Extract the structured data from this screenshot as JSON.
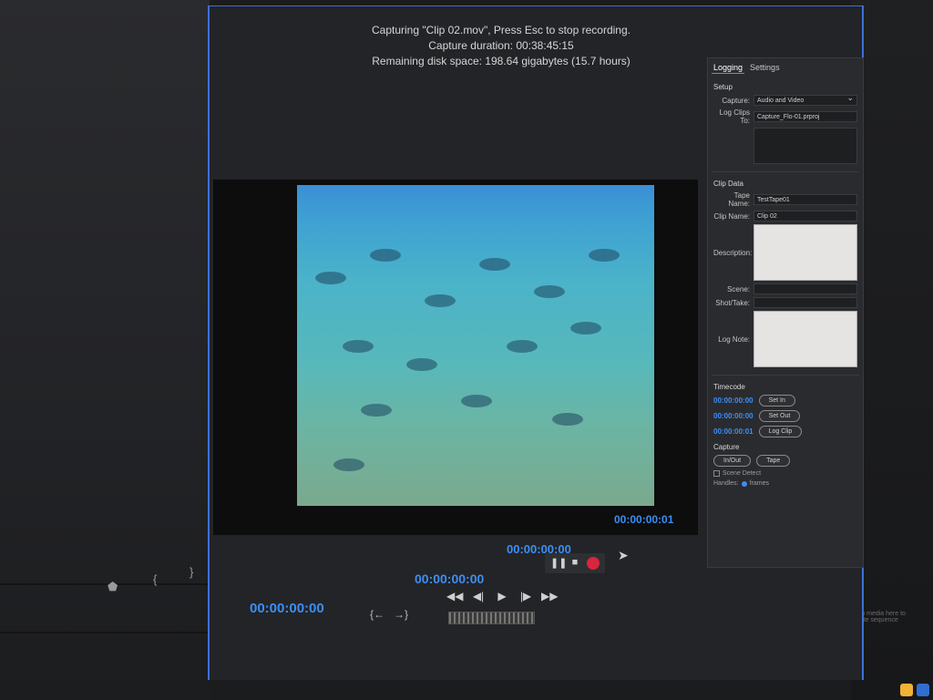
{
  "status": {
    "line1": "Capturing \"Clip 02.mov\", Press Esc to stop recording.",
    "line2": "Capture duration: 00:38:45:15",
    "line3": "Remaining disk space: 198.64 gigabytes (15.7 hours)"
  },
  "panel": {
    "tab_logging": "Logging",
    "tab_settings": "Settings",
    "setup_title": "Setup",
    "capture_label": "Capture:",
    "capture_value": "Audio and Video",
    "logclips_label": "Log Clips To:",
    "logclips_value": "Capture_Flo-01.prproj",
    "clipdata_title": "Clip Data",
    "tape_label": "Tape Name:",
    "tape_value": "TestTape01",
    "clip_label": "Clip Name:",
    "clip_value": "Clip 02",
    "desc_label": "Description:",
    "scene_label": "Scene:",
    "shot_label": "Shot/Take:",
    "lognote_label": "Log Note:",
    "timecode_title": "Timecode",
    "tc_in": "00:00:00:00",
    "tc_out": "00:00:00:00",
    "tc_dur": "00:00:00:01",
    "set_in": "Set In",
    "set_out": "Set Out",
    "log_clip": "Log Clip",
    "capture_title": "Capture",
    "in_out": "In/Out",
    "tape": "Tape",
    "scene_detect": "Scene Detect",
    "handles_label": "Handles:",
    "frames_label": "frames"
  },
  "monitor": {
    "timecode_right": "00:00:00:01",
    "timecode_left": "00:00:00:00",
    "timecode_mid": "00:00:00:00",
    "timecode_top": "00:00:00:00"
  },
  "background": {
    "note": "Drop media here to create sequence"
  }
}
